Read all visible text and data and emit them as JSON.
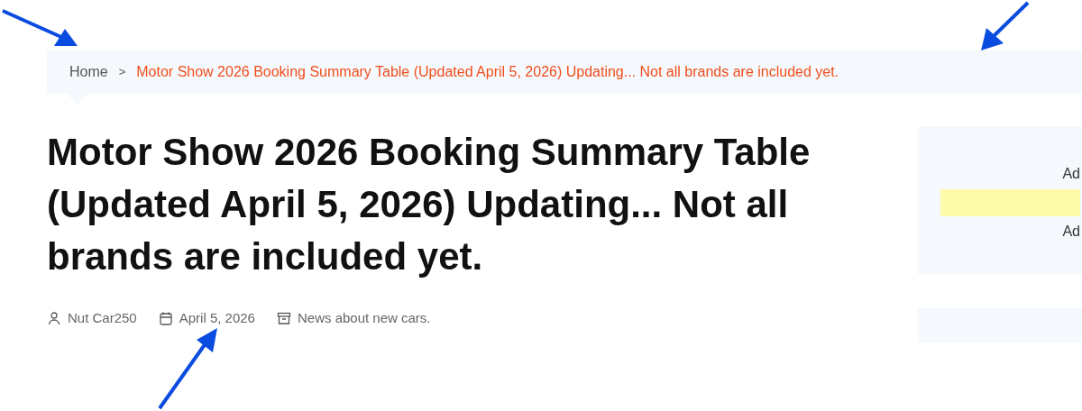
{
  "breadcrumb": {
    "items": [
      {
        "label": "Home",
        "current": false
      },
      {
        "label": "Motor Show 2026 Booking Summary Table (Updated April 5, 2026) Updating... Not all brands are included yet.",
        "current": true
      }
    ],
    "separator": ">"
  },
  "article": {
    "title": "Motor Show 2026 Booking Summary Table (Updated April 5, 2026) Updating... Not all brands are included yet.",
    "meta": [
      {
        "kind": "author",
        "text": "Nut Car250"
      },
      {
        "kind": "date",
        "text": "April 5, 2026"
      },
      {
        "kind": "category",
        "text": "News about new cars."
      }
    ]
  },
  "sidebar": {
    "ads": [
      "Ad",
      "Ad"
    ]
  }
}
